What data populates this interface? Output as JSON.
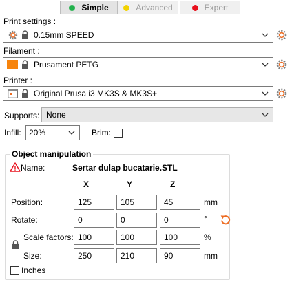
{
  "modes": [
    {
      "label": "Simple",
      "color": "#22b14c",
      "active": true
    },
    {
      "label": "Advanced",
      "color": "#f2d200",
      "active": false
    },
    {
      "label": "Expert",
      "color": "#e8101c",
      "active": false
    }
  ],
  "print_settings": {
    "label": "Print settings :",
    "value": "0.15mm SPEED"
  },
  "filament": {
    "label": "Filament :",
    "value": "Prusament PETG",
    "swatch_color": "#f7840d"
  },
  "printer": {
    "label": "Printer :",
    "value": "Original Prusa i3 MK3S & MK3S+"
  },
  "supports": {
    "label": "Supports:",
    "value": "None"
  },
  "infill": {
    "label": "Infill:",
    "value": "20%"
  },
  "brim": {
    "label": "Brim:",
    "checked": false
  },
  "object_manipulation": {
    "title": "Object manipulation",
    "name_label": "Name:",
    "name_value": "Sertar dulap bucatarie.STL",
    "axes": [
      "X",
      "Y",
      "Z"
    ],
    "position": {
      "label": "Position:",
      "values": [
        "125",
        "105",
        "45"
      ],
      "unit": "mm"
    },
    "rotate": {
      "label": "Rotate:",
      "values": [
        "0",
        "0",
        "0"
      ],
      "unit": "°"
    },
    "scale": {
      "label": "Scale factors:",
      "values": [
        "100",
        "100",
        "100"
      ],
      "unit": "%"
    },
    "size": {
      "label": "Size:",
      "values": [
        "250",
        "210",
        "90"
      ],
      "unit": "mm"
    },
    "inches": {
      "label": "Inches",
      "checked": false
    }
  },
  "colors": {
    "accent_orange": "#ed6b21",
    "warning": "#e8101c"
  }
}
